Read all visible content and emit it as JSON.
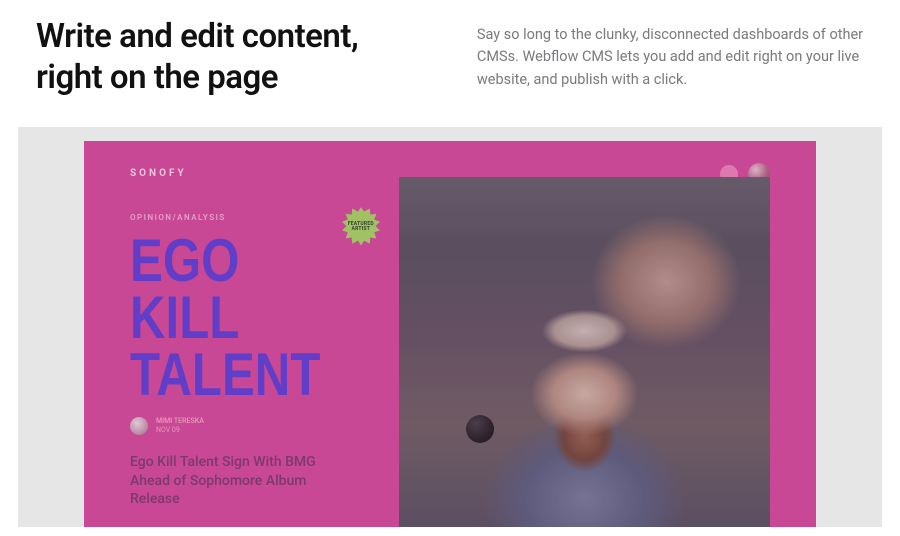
{
  "header": {
    "headline": "Write and edit content, right on the page",
    "description": "Say so long to the clunky, disconnected dashboards of other CMSs. Webflow CMS lets you add and edit right on your live website, and publish with a click."
  },
  "site": {
    "brand": "SONOFY",
    "category": "OPINION/ANALYSIS",
    "hero_title": "EGO KILL TALENT",
    "badge": "FEATURED ARTIST",
    "author": {
      "name": "MIMI TERESKA",
      "date": "NOV 09"
    },
    "subtitle": "Ego Kill Talent Sign With BMG Ahead of Sophomore Album Release"
  }
}
